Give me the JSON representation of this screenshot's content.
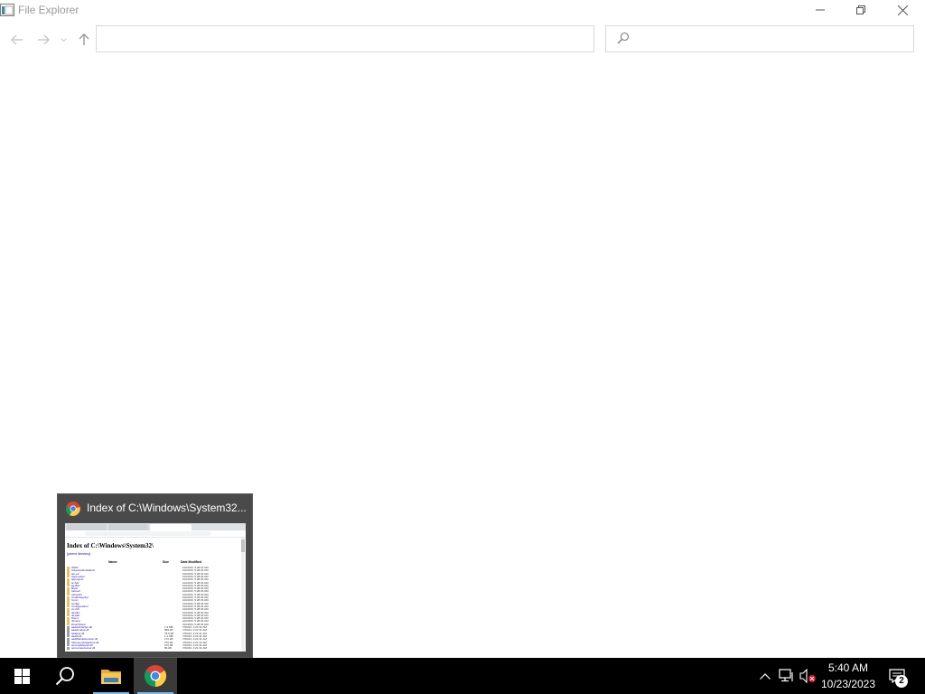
{
  "window": {
    "title": "File Explorer",
    "controls": {
      "minimize": "minimize-icon",
      "restore": "restore-icon",
      "close": "close-icon"
    }
  },
  "navigation": {
    "back": "back-arrow-icon",
    "forward": "forward-arrow-icon",
    "recent": "chevron-down-icon",
    "up": "up-arrow-icon"
  },
  "address_bar": {
    "value": "",
    "dropdown": "chevron-down-icon",
    "refresh": "refresh-icon"
  },
  "search": {
    "value": "",
    "placeholder": "",
    "icon": "search-icon"
  },
  "taskbar_thumbnail": {
    "title": "Index of C:\\Windows\\System32...",
    "preview": {
      "heading": "Index of C:\\Windows\\System32\\",
      "parent_link": "[parent directory]",
      "columns": [
        "Name",
        "Size",
        "Date Modified"
      ],
      "rows": [
        {
          "name": "0409/",
          "size": "",
          "date": "10/23/23, 5:28:31 AM"
        },
        {
          "name": "AdvancedInstallers/",
          "size": "",
          "date": "10/23/23, 5:28:33 AM"
        },
        {
          "name": "am-et/",
          "size": "",
          "date": "10/23/23, 5:28:33 AM"
        },
        {
          "name": "AppLocker/",
          "size": "",
          "date": "10/23/23, 5:28:33 AM"
        },
        {
          "name": "appmgmt/",
          "size": "",
          "date": "10/23/23, 5:28:33 AM"
        },
        {
          "name": "ar-SA/",
          "size": "",
          "date": "10/23/23, 5:28:33 AM"
        },
        {
          "name": "bg-BG/",
          "size": "",
          "date": "10/23/23, 5:28:33 AM"
        },
        {
          "name": "Boot/",
          "size": "",
          "date": "10/23/23, 5:28:33 AM"
        },
        {
          "name": "catroot/",
          "size": "",
          "date": "10/23/23, 5:28:33 AM"
        },
        {
          "name": "catroot2/",
          "size": "",
          "date": "10/23/23, 5:28:33 AM"
        },
        {
          "name": "CodeIntegrity/",
          "size": "",
          "date": "10/23/23, 5:28:33 AM"
        },
        {
          "name": "Com/",
          "size": "",
          "date": "10/23/23, 5:28:33 AM"
        },
        {
          "name": "config/",
          "size": "",
          "date": "10/23/23, 5:28:33 AM"
        },
        {
          "name": "Configuration/",
          "size": "",
          "date": "10/23/23, 5:28:33 AM"
        },
        {
          "name": "cs-CZ/",
          "size": "",
          "date": "10/23/23, 5:28:33 AM"
        },
        {
          "name": "da-DK/",
          "size": "",
          "date": "10/23/23, 5:28:33 AM"
        },
        {
          "name": "de-DE/",
          "size": "",
          "date": "10/23/23, 5:28:33 AM"
        },
        {
          "name": "Dism/",
          "size": "",
          "date": "10/23/23, 5:28:33 AM"
        },
        {
          "name": "drivers/",
          "size": "",
          "date": "10/23/23, 5:28:33 AM"
        },
        {
          "name": "DriverStore/",
          "size": "",
          "date": "10/23/23, 5:28:33 AM"
        },
        {
          "name": "aadauthhelper.dll",
          "size": "1.3 MB",
          "date": "7/20/23, 2:21:31 AM"
        },
        {
          "name": "aadcloudap.dll",
          "size": "899 kB",
          "date": "7/20/23, 2:21:31 AM"
        },
        {
          "name": "aadjcsp.dll",
          "size": "78.5 kB",
          "date": "7/20/23, 2:21:31 AM"
        },
        {
          "name": "aadtb.dll",
          "size": "1.4 MB",
          "date": "7/20/23, 2:21:31 AM"
        },
        {
          "name": "aadWamExtension.dll",
          "size": "170 kB",
          "date": "7/20/23, 2:21:31 AM"
        },
        {
          "name": "AboveLockAppHost.dll",
          "size": "270 kB",
          "date": "7/20/23, 2:21:31 AM"
        },
        {
          "name": "accessibilitycpl.dll",
          "size": "270 kB",
          "date": "7/20/23, 2:21:31 AM"
        },
        {
          "name": "accountaccessor.dll",
          "size": "89 kB",
          "date": "7/20/23, 2:21:31 AM"
        }
      ]
    }
  },
  "taskbar": {
    "start": "windows-logo-icon",
    "search": "search-icon",
    "apps": [
      {
        "name": "File Explorer",
        "icon": "folder-icon"
      },
      {
        "name": "Google Chrome",
        "icon": "chrome-icon"
      }
    ],
    "tray": {
      "chevron": "chevron-up-icon",
      "network": "network-icon",
      "volume": "volume-muted-icon"
    },
    "clock": {
      "time": "5:40 AM",
      "date": "10/23/2023"
    },
    "notifications": {
      "icon": "action-center-icon",
      "count": "2"
    }
  }
}
